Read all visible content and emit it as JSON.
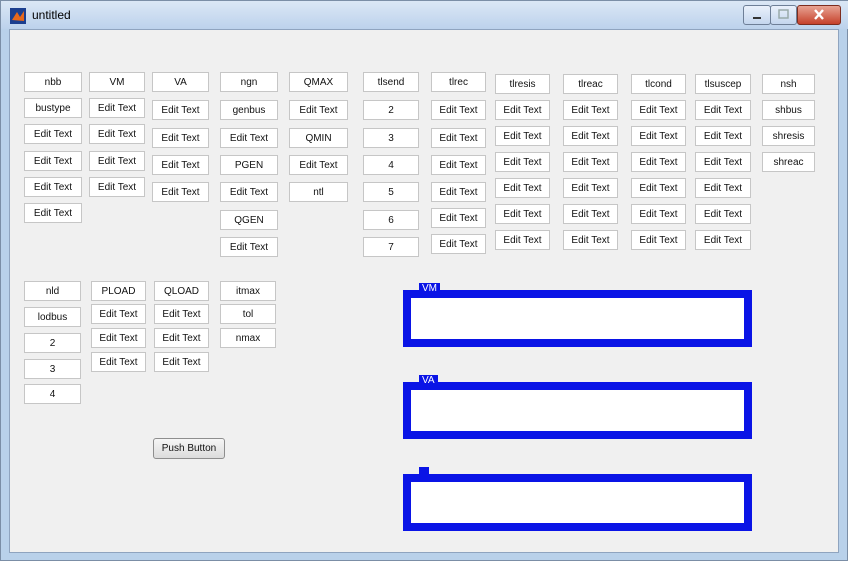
{
  "window": {
    "title": "untitled"
  },
  "colors": {
    "panel_border": "#0a14e6",
    "titlebar": "#bcd2ec"
  },
  "icons": [
    "matlab-figure-icon",
    "minimize-icon",
    "maximize-icon",
    "close-icon"
  ],
  "controls": {
    "c0": "nbb",
    "c1": "bustype",
    "c2": "Edit Text",
    "c3": "Edit Text",
    "c4": "Edit Text",
    "c5": "Edit Text",
    "c6": "VM",
    "c7": "Edit Text",
    "c8": "Edit Text",
    "c9": "Edit Text",
    "c10": "Edit Text",
    "c11": "VA",
    "c12": "Edit Text",
    "c13": "Edit Text",
    "c14": "Edit Text",
    "c15": "Edit Text",
    "c16": "ngn",
    "c17": "genbus",
    "c18": "Edit Text",
    "c19": "PGEN",
    "c20": "Edit Text",
    "c21": "QGEN",
    "c22": "Edit Text",
    "c23": "QMAX",
    "c24": "Edit Text",
    "c25": "QMIN",
    "c26": "Edit Text",
    "c27": "ntl",
    "c28": "tlsend",
    "c29": "2",
    "c30": "3",
    "c31": "4",
    "c32": "5",
    "c33": "6",
    "c34": "7",
    "c35": "tlrec",
    "c36": "Edit Text",
    "c37": "Edit Text",
    "c38": "Edit Text",
    "c39": "Edit Text",
    "c40": "Edit Text",
    "c41": "Edit Text",
    "c42": "tlresis",
    "c43": "Edit Text",
    "c44": "Edit Text",
    "c45": "Edit Text",
    "c46": "Edit Text",
    "c47": "Edit Text",
    "c48": "Edit Text",
    "c49": "tlreac",
    "c50": "Edit Text",
    "c51": "Edit Text",
    "c52": "Edit Text",
    "c53": "Edit Text",
    "c54": "Edit Text",
    "c55": "Edit Text",
    "c56": "tlcond",
    "c57": "Edit Text",
    "c58": "Edit Text",
    "c59": "Edit Text",
    "c60": "Edit Text",
    "c61": "Edit Text",
    "c62": "Edit Text",
    "c63": "tlsuscep",
    "c64": "Edit Text",
    "c65": "Edit Text",
    "c66": "Edit Text",
    "c67": "Edit Text",
    "c68": "Edit Text",
    "c69": "Edit Text",
    "c70": "nsh",
    "c71": "shbus",
    "c72": "shresis",
    "c73": "shreac",
    "c74": "nld",
    "c75": "lodbus",
    "c76": "2",
    "c77": "3",
    "c78": "4",
    "c79": "PLOAD",
    "c80": "Edit Text",
    "c81": "Edit Text",
    "c82": "Edit Text",
    "c83": "QLOAD",
    "c84": "Edit Text",
    "c85": "Edit Text",
    "c86": "Edit Text",
    "c87": "itmax",
    "c88": "tol",
    "c89": "nmax"
  },
  "push_button": {
    "label": "Push Button"
  },
  "panels": {
    "vm_title": "VM",
    "va_title": "VA",
    "third_title": ""
  }
}
